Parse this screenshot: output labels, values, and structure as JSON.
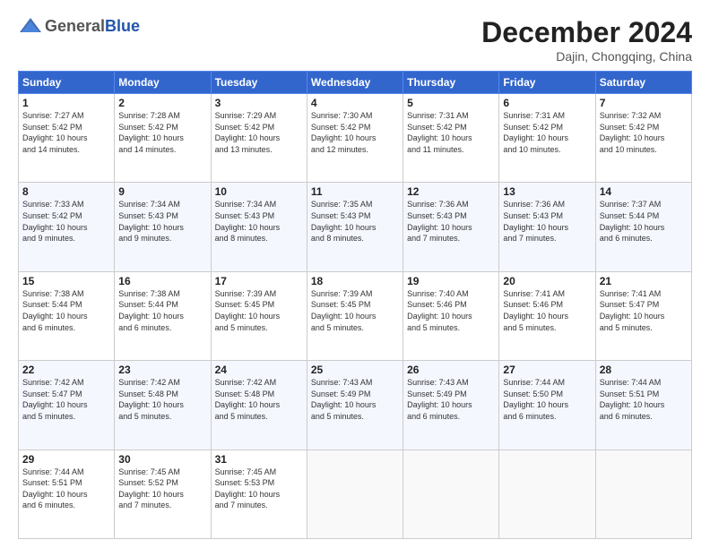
{
  "header": {
    "logo_general": "General",
    "logo_blue": "Blue",
    "month_title": "December 2024",
    "location": "Dajin, Chongqing, China"
  },
  "weekdays": [
    "Sunday",
    "Monday",
    "Tuesday",
    "Wednesday",
    "Thursday",
    "Friday",
    "Saturday"
  ],
  "weeks": [
    [
      {
        "day": "1",
        "info": "Sunrise: 7:27 AM\nSunset: 5:42 PM\nDaylight: 10 hours\nand 14 minutes."
      },
      {
        "day": "2",
        "info": "Sunrise: 7:28 AM\nSunset: 5:42 PM\nDaylight: 10 hours\nand 14 minutes."
      },
      {
        "day": "3",
        "info": "Sunrise: 7:29 AM\nSunset: 5:42 PM\nDaylight: 10 hours\nand 13 minutes."
      },
      {
        "day": "4",
        "info": "Sunrise: 7:30 AM\nSunset: 5:42 PM\nDaylight: 10 hours\nand 12 minutes."
      },
      {
        "day": "5",
        "info": "Sunrise: 7:31 AM\nSunset: 5:42 PM\nDaylight: 10 hours\nand 11 minutes."
      },
      {
        "day": "6",
        "info": "Sunrise: 7:31 AM\nSunset: 5:42 PM\nDaylight: 10 hours\nand 10 minutes."
      },
      {
        "day": "7",
        "info": "Sunrise: 7:32 AM\nSunset: 5:42 PM\nDaylight: 10 hours\nand 10 minutes."
      }
    ],
    [
      {
        "day": "8",
        "info": "Sunrise: 7:33 AM\nSunset: 5:42 PM\nDaylight: 10 hours\nand 9 minutes."
      },
      {
        "day": "9",
        "info": "Sunrise: 7:34 AM\nSunset: 5:43 PM\nDaylight: 10 hours\nand 9 minutes."
      },
      {
        "day": "10",
        "info": "Sunrise: 7:34 AM\nSunset: 5:43 PM\nDaylight: 10 hours\nand 8 minutes."
      },
      {
        "day": "11",
        "info": "Sunrise: 7:35 AM\nSunset: 5:43 PM\nDaylight: 10 hours\nand 8 minutes."
      },
      {
        "day": "12",
        "info": "Sunrise: 7:36 AM\nSunset: 5:43 PM\nDaylight: 10 hours\nand 7 minutes."
      },
      {
        "day": "13",
        "info": "Sunrise: 7:36 AM\nSunset: 5:43 PM\nDaylight: 10 hours\nand 7 minutes."
      },
      {
        "day": "14",
        "info": "Sunrise: 7:37 AM\nSunset: 5:44 PM\nDaylight: 10 hours\nand 6 minutes."
      }
    ],
    [
      {
        "day": "15",
        "info": "Sunrise: 7:38 AM\nSunset: 5:44 PM\nDaylight: 10 hours\nand 6 minutes."
      },
      {
        "day": "16",
        "info": "Sunrise: 7:38 AM\nSunset: 5:44 PM\nDaylight: 10 hours\nand 6 minutes."
      },
      {
        "day": "17",
        "info": "Sunrise: 7:39 AM\nSunset: 5:45 PM\nDaylight: 10 hours\nand 5 minutes."
      },
      {
        "day": "18",
        "info": "Sunrise: 7:39 AM\nSunset: 5:45 PM\nDaylight: 10 hours\nand 5 minutes."
      },
      {
        "day": "19",
        "info": "Sunrise: 7:40 AM\nSunset: 5:46 PM\nDaylight: 10 hours\nand 5 minutes."
      },
      {
        "day": "20",
        "info": "Sunrise: 7:41 AM\nSunset: 5:46 PM\nDaylight: 10 hours\nand 5 minutes."
      },
      {
        "day": "21",
        "info": "Sunrise: 7:41 AM\nSunset: 5:47 PM\nDaylight: 10 hours\nand 5 minutes."
      }
    ],
    [
      {
        "day": "22",
        "info": "Sunrise: 7:42 AM\nSunset: 5:47 PM\nDaylight: 10 hours\nand 5 minutes."
      },
      {
        "day": "23",
        "info": "Sunrise: 7:42 AM\nSunset: 5:48 PM\nDaylight: 10 hours\nand 5 minutes."
      },
      {
        "day": "24",
        "info": "Sunrise: 7:42 AM\nSunset: 5:48 PM\nDaylight: 10 hours\nand 5 minutes."
      },
      {
        "day": "25",
        "info": "Sunrise: 7:43 AM\nSunset: 5:49 PM\nDaylight: 10 hours\nand 5 minutes."
      },
      {
        "day": "26",
        "info": "Sunrise: 7:43 AM\nSunset: 5:49 PM\nDaylight: 10 hours\nand 6 minutes."
      },
      {
        "day": "27",
        "info": "Sunrise: 7:44 AM\nSunset: 5:50 PM\nDaylight: 10 hours\nand 6 minutes."
      },
      {
        "day": "28",
        "info": "Sunrise: 7:44 AM\nSunset: 5:51 PM\nDaylight: 10 hours\nand 6 minutes."
      }
    ],
    [
      {
        "day": "29",
        "info": "Sunrise: 7:44 AM\nSunset: 5:51 PM\nDaylight: 10 hours\nand 6 minutes."
      },
      {
        "day": "30",
        "info": "Sunrise: 7:45 AM\nSunset: 5:52 PM\nDaylight: 10 hours\nand 7 minutes."
      },
      {
        "day": "31",
        "info": "Sunrise: 7:45 AM\nSunset: 5:53 PM\nDaylight: 10 hours\nand 7 minutes."
      },
      {
        "day": "",
        "info": ""
      },
      {
        "day": "",
        "info": ""
      },
      {
        "day": "",
        "info": ""
      },
      {
        "day": "",
        "info": ""
      }
    ]
  ]
}
